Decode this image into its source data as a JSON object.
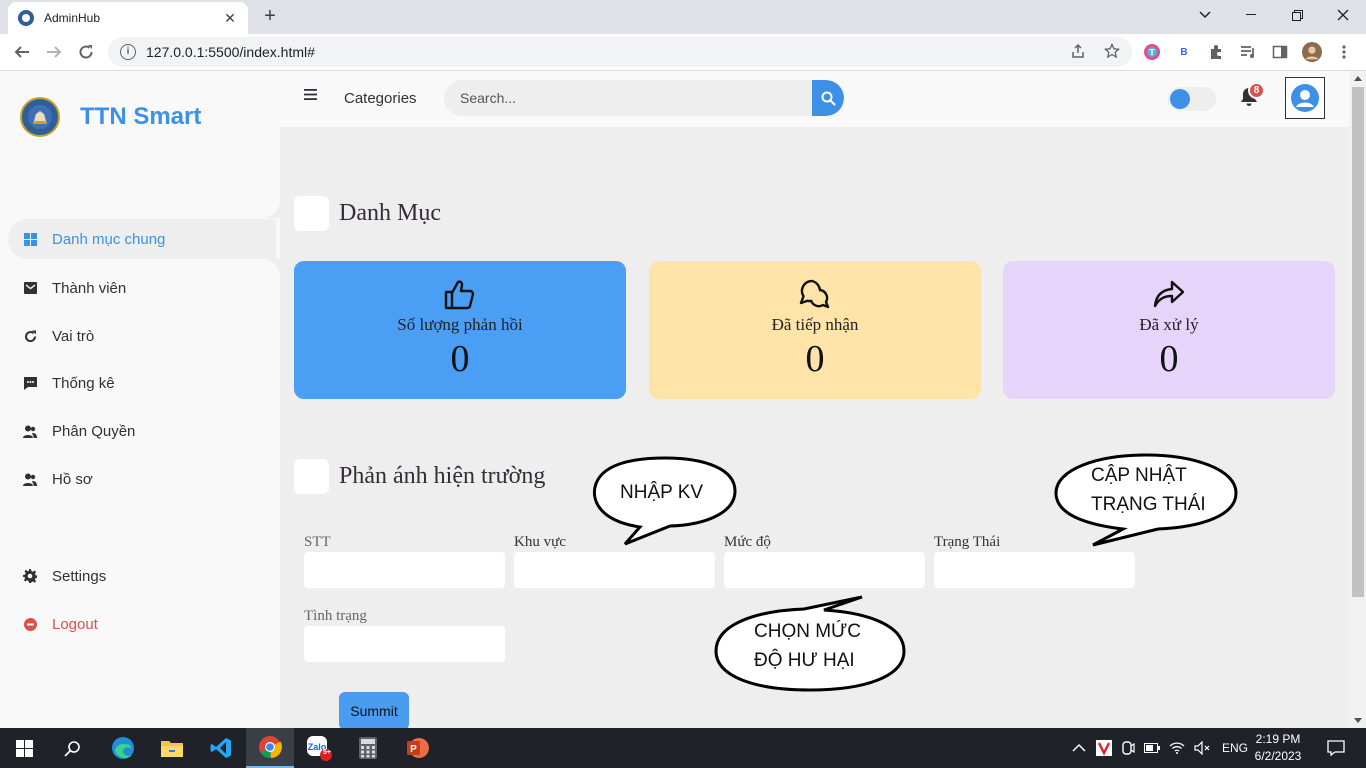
{
  "browser": {
    "tab_title": "AdminHub",
    "url": "127.0.0.1:5500/index.html#",
    "new_tab": "+",
    "ext_b_label": "B"
  },
  "brand": {
    "name": "TTN Smart"
  },
  "sidebar": {
    "items": [
      {
        "label": "Danh mục chung",
        "icon": "dashboard-icon",
        "active": true
      },
      {
        "label": "Thành viên",
        "icon": "envelope-icon"
      },
      {
        "label": "Vai trò",
        "icon": "reload-icon"
      },
      {
        "label": "Thống kê",
        "icon": "message-icon"
      },
      {
        "label": "Phân Quyền",
        "icon": "users-icon"
      },
      {
        "label": "Hồ sơ",
        "icon": "users-icon"
      }
    ],
    "settings": "Settings",
    "logout": "Logout"
  },
  "topnav": {
    "categories": "Categories",
    "search_placeholder": "Search...",
    "notification_count": "8"
  },
  "main": {
    "section1_title": "Danh Mục",
    "cards": [
      {
        "label": "Số lượng phản hồi",
        "value": "0",
        "color": "#4a9ff5",
        "icon": "thumbs-up-icon"
      },
      {
        "label": "Đã tiếp nhận",
        "value": "0",
        "color": "#ffe4a9",
        "icon": "chat-icon"
      },
      {
        "label": "Đã xử lý",
        "value": "0",
        "color": "#e6d4fa",
        "icon": "share-icon"
      }
    ],
    "section2_title": "Phản ánh hiện trường",
    "form": {
      "stt": "STT",
      "khu_vuc": "Khu vực",
      "muc_do": "Mức độ",
      "trang_thai": "Trạng Thái",
      "tinh_trang": "Tình trạng",
      "submit": "Summit"
    },
    "bubbles": {
      "nhap_kv": "NHẬP KV",
      "cap_nhat_1": "CẬP NHẬT",
      "cap_nhat_2": "TRẠNG THÁI",
      "chon_1": "CHỌN MỨC",
      "chon_2": "ĐỘ HƯ HẠI"
    }
  },
  "taskbar": {
    "time": "2:19 PM",
    "date": "6/2/2023",
    "lang": "ENG",
    "zalo_badge": "5+"
  },
  "colors": {
    "accent": "#3c91e6",
    "danger": "#db504a",
    "sidebar_bg": "#f9f9f9",
    "page_bg": "#eeeeee"
  }
}
